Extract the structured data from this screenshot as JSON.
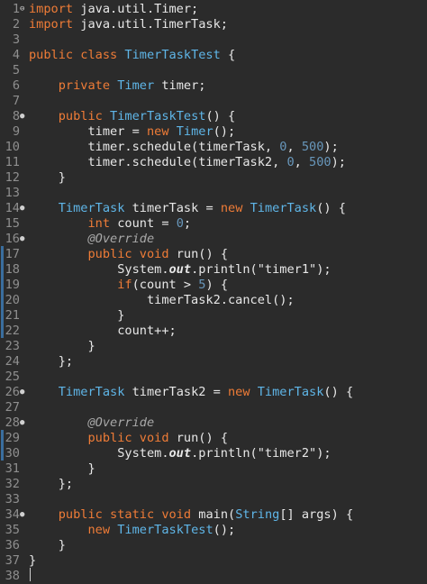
{
  "editor": {
    "lines": [
      {
        "n": "1",
        "marker": "⊖",
        "tokens": [
          {
            "t": "import",
            "c": "kw"
          },
          {
            "t": " java.util.Timer;",
            "c": "plain"
          }
        ]
      },
      {
        "n": "2",
        "marker": "",
        "tokens": [
          {
            "t": "import",
            "c": "kw"
          },
          {
            "t": " java.util.TimerTask;",
            "c": "plain"
          }
        ]
      },
      {
        "n": "3",
        "marker": "",
        "tokens": []
      },
      {
        "n": "4",
        "marker": "",
        "tokens": [
          {
            "t": "public",
            "c": "kw"
          },
          {
            "t": " ",
            "c": "plain"
          },
          {
            "t": "class",
            "c": "kw"
          },
          {
            "t": " ",
            "c": "plain"
          },
          {
            "t": "TimerTaskTest",
            "c": "type"
          },
          {
            "t": " {",
            "c": "plain"
          }
        ]
      },
      {
        "n": "5",
        "marker": "",
        "tokens": []
      },
      {
        "n": "6",
        "marker": "",
        "tokens": [
          {
            "t": "    ",
            "c": "plain"
          },
          {
            "t": "private",
            "c": "kw"
          },
          {
            "t": " ",
            "c": "plain"
          },
          {
            "t": "Timer",
            "c": "type"
          },
          {
            "t": " timer;",
            "c": "plain"
          }
        ]
      },
      {
        "n": "7",
        "marker": "",
        "tokens": []
      },
      {
        "n": "8",
        "marker": "●",
        "tokens": [
          {
            "t": "    ",
            "c": "plain"
          },
          {
            "t": "public",
            "c": "kw"
          },
          {
            "t": " ",
            "c": "plain"
          },
          {
            "t": "TimerTaskTest",
            "c": "type"
          },
          {
            "t": "() {",
            "c": "plain"
          }
        ]
      },
      {
        "n": "9",
        "marker": "",
        "tokens": [
          {
            "t": "        timer = ",
            "c": "plain"
          },
          {
            "t": "new",
            "c": "kw"
          },
          {
            "t": " ",
            "c": "plain"
          },
          {
            "t": "Timer",
            "c": "type"
          },
          {
            "t": "();",
            "c": "plain"
          }
        ]
      },
      {
        "n": "10",
        "marker": "",
        "tokens": [
          {
            "t": "        timer.schedule(timerTask, ",
            "c": "plain"
          },
          {
            "t": "0",
            "c": "num"
          },
          {
            "t": ", ",
            "c": "plain"
          },
          {
            "t": "500",
            "c": "num"
          },
          {
            "t": ");",
            "c": "plain"
          }
        ]
      },
      {
        "n": "11",
        "marker": "",
        "tokens": [
          {
            "t": "        timer.schedule(timerTask2, ",
            "c": "plain"
          },
          {
            "t": "0",
            "c": "num"
          },
          {
            "t": ", ",
            "c": "plain"
          },
          {
            "t": "500",
            "c": "num"
          },
          {
            "t": ");",
            "c": "plain"
          }
        ]
      },
      {
        "n": "12",
        "marker": "",
        "tokens": [
          {
            "t": "    }",
            "c": "plain"
          }
        ]
      },
      {
        "n": "13",
        "marker": "",
        "tokens": []
      },
      {
        "n": "14",
        "marker": "●",
        "tokens": [
          {
            "t": "    ",
            "c": "plain"
          },
          {
            "t": "TimerTask",
            "c": "type"
          },
          {
            "t": " timerTask = ",
            "c": "plain"
          },
          {
            "t": "new",
            "c": "kw"
          },
          {
            "t": " ",
            "c": "plain"
          },
          {
            "t": "TimerTask",
            "c": "type"
          },
          {
            "t": "() {",
            "c": "plain"
          }
        ]
      },
      {
        "n": "15",
        "marker": "",
        "tokens": [
          {
            "t": "        ",
            "c": "plain"
          },
          {
            "t": "int",
            "c": "kw"
          },
          {
            "t": " count = ",
            "c": "plain"
          },
          {
            "t": "0",
            "c": "num"
          },
          {
            "t": ";",
            "c": "plain"
          }
        ]
      },
      {
        "n": "16",
        "marker": "●",
        "tokens": [
          {
            "t": "        ",
            "c": "plain"
          },
          {
            "t": "@Override",
            "c": "ann"
          }
        ]
      },
      {
        "n": "17",
        "marker": "",
        "tokens": [
          {
            "t": "        ",
            "c": "plain"
          },
          {
            "t": "public",
            "c": "kw"
          },
          {
            "t": " ",
            "c": "plain"
          },
          {
            "t": "void",
            "c": "kw"
          },
          {
            "t": " run() {",
            "c": "plain"
          }
        ]
      },
      {
        "n": "18",
        "marker": "",
        "tokens": [
          {
            "t": "            System.",
            "c": "plain"
          },
          {
            "t": "out",
            "c": "static"
          },
          {
            "t": ".println(\"timer1\");",
            "c": "plain"
          }
        ]
      },
      {
        "n": "19",
        "marker": "",
        "tokens": [
          {
            "t": "            ",
            "c": "plain"
          },
          {
            "t": "if",
            "c": "kw"
          },
          {
            "t": "(count > ",
            "c": "plain"
          },
          {
            "t": "5",
            "c": "num"
          },
          {
            "t": ") {",
            "c": "plain"
          }
        ]
      },
      {
        "n": "20",
        "marker": "",
        "tokens": [
          {
            "t": "                timerTask2.cancel();",
            "c": "plain"
          }
        ]
      },
      {
        "n": "21",
        "marker": "",
        "tokens": [
          {
            "t": "            }",
            "c": "plain"
          }
        ]
      },
      {
        "n": "22",
        "marker": "",
        "tokens": [
          {
            "t": "            count++;",
            "c": "plain"
          }
        ]
      },
      {
        "n": "23",
        "marker": "",
        "tokens": [
          {
            "t": "        }",
            "c": "plain"
          }
        ]
      },
      {
        "n": "24",
        "marker": "",
        "tokens": [
          {
            "t": "    };",
            "c": "plain"
          }
        ]
      },
      {
        "n": "25",
        "marker": "",
        "tokens": []
      },
      {
        "n": "26",
        "marker": "●",
        "tokens": [
          {
            "t": "    ",
            "c": "plain"
          },
          {
            "t": "TimerTask",
            "c": "type"
          },
          {
            "t": " timerTask2 = ",
            "c": "plain"
          },
          {
            "t": "new",
            "c": "kw"
          },
          {
            "t": " ",
            "c": "plain"
          },
          {
            "t": "TimerTask",
            "c": "type"
          },
          {
            "t": "() {",
            "c": "plain"
          }
        ]
      },
      {
        "n": "27",
        "marker": "",
        "tokens": []
      },
      {
        "n": "28",
        "marker": "●",
        "tokens": [
          {
            "t": "        ",
            "c": "plain"
          },
          {
            "t": "@Override",
            "c": "ann"
          }
        ]
      },
      {
        "n": "29",
        "marker": "",
        "tokens": [
          {
            "t": "        ",
            "c": "plain"
          },
          {
            "t": "public",
            "c": "kw"
          },
          {
            "t": " ",
            "c": "plain"
          },
          {
            "t": "void",
            "c": "kw"
          },
          {
            "t": " run() {",
            "c": "plain"
          }
        ]
      },
      {
        "n": "30",
        "marker": "",
        "tokens": [
          {
            "t": "            System.",
            "c": "plain"
          },
          {
            "t": "out",
            "c": "static"
          },
          {
            "t": ".println(\"timer2\");",
            "c": "plain"
          }
        ]
      },
      {
        "n": "31",
        "marker": "",
        "tokens": [
          {
            "t": "        }",
            "c": "plain"
          }
        ]
      },
      {
        "n": "32",
        "marker": "",
        "tokens": [
          {
            "t": "    };",
            "c": "plain"
          }
        ]
      },
      {
        "n": "33",
        "marker": "",
        "tokens": []
      },
      {
        "n": "34",
        "marker": "●",
        "tokens": [
          {
            "t": "    ",
            "c": "plain"
          },
          {
            "t": "public",
            "c": "kw"
          },
          {
            "t": " ",
            "c": "plain"
          },
          {
            "t": "static",
            "c": "kw"
          },
          {
            "t": " ",
            "c": "plain"
          },
          {
            "t": "void",
            "c": "kw"
          },
          {
            "t": " main(",
            "c": "plain"
          },
          {
            "t": "String",
            "c": "type"
          },
          {
            "t": "[] args) {",
            "c": "plain"
          }
        ]
      },
      {
        "n": "35",
        "marker": "",
        "tokens": [
          {
            "t": "        ",
            "c": "plain"
          },
          {
            "t": "new",
            "c": "kw"
          },
          {
            "t": " ",
            "c": "plain"
          },
          {
            "t": "TimerTaskTest",
            "c": "type"
          },
          {
            "t": "();",
            "c": "plain"
          }
        ]
      },
      {
        "n": "36",
        "marker": "",
        "tokens": [
          {
            "t": "    }",
            "c": "plain"
          }
        ]
      },
      {
        "n": "37",
        "marker": "",
        "tokens": [
          {
            "t": "}",
            "c": "plain"
          }
        ]
      },
      {
        "n": "38",
        "marker": "",
        "tokens": []
      }
    ],
    "colors": {
      "background": "#2b2b2b",
      "keyword": "#ef7c37",
      "type": "#5fb6e8",
      "number": "#6897bb",
      "annotation": "#a8a8a8",
      "text": "#e8e8e8",
      "line_number": "#8f8f8f",
      "change_bar": "#3a6e9e"
    }
  }
}
